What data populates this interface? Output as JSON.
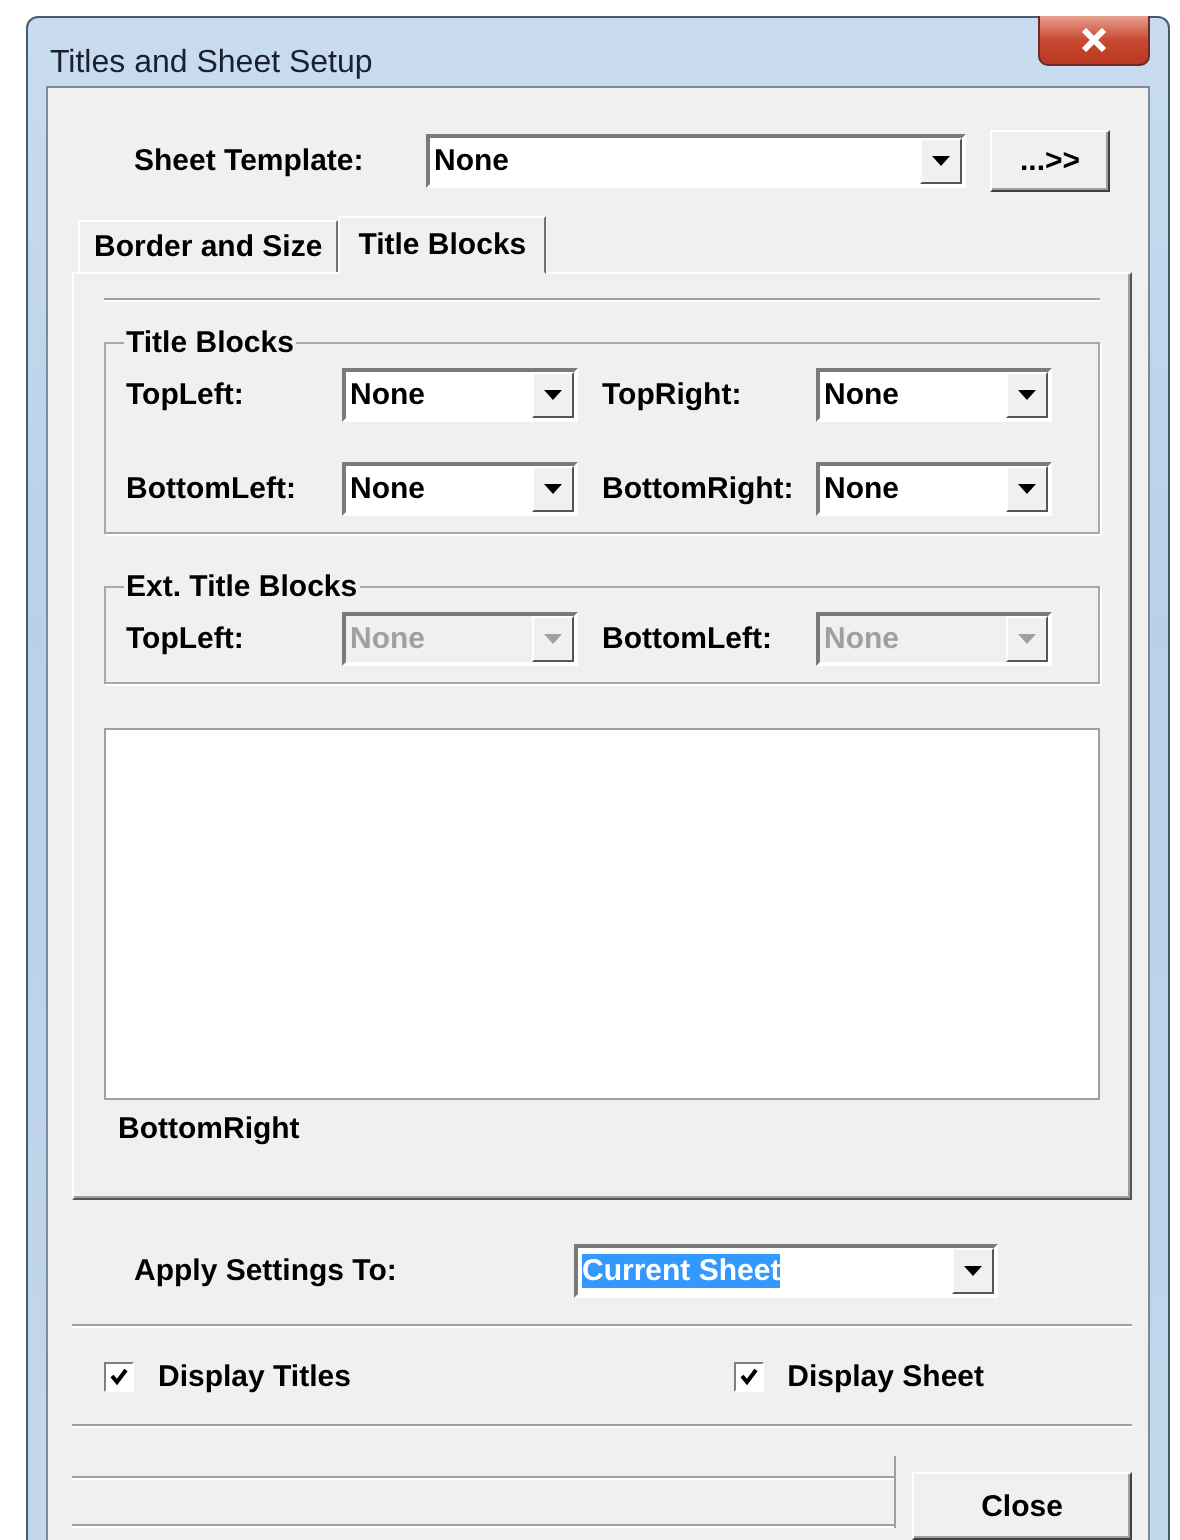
{
  "window": {
    "title": "Titles and Sheet Setup"
  },
  "sheet_template": {
    "label": "Sheet Template:",
    "value": "None"
  },
  "more_button": "...>>",
  "tabs": [
    {
      "label": "Border and Size",
      "selected": false
    },
    {
      "label": "Title Blocks",
      "selected": true
    }
  ],
  "groups": [
    {
      "title": "Title Blocks",
      "fields": [
        {
          "label": "TopLeft:",
          "value": "None",
          "disabled": false
        },
        {
          "label": "TopRight:",
          "value": "None",
          "disabled": false
        },
        {
          "label": "BottomLeft:",
          "value": "None",
          "disabled": false
        },
        {
          "label": "BottomRight:",
          "value": "None",
          "disabled": false
        }
      ]
    },
    {
      "title": "Ext. Title Blocks",
      "fields": [
        {
          "label": "TopLeft:",
          "value": "None",
          "disabled": true
        },
        {
          "label": "BottomLeft:",
          "value": "None",
          "disabled": true
        }
      ]
    }
  ],
  "preview": {
    "caption": "BottomRight"
  },
  "apply": {
    "label": "Apply Settings To:",
    "value": "Current Sheet"
  },
  "checkboxes": [
    {
      "label": "Display Titles",
      "checked": true
    },
    {
      "label": "Display Sheet",
      "checked": true
    }
  ],
  "close_button": "Close"
}
